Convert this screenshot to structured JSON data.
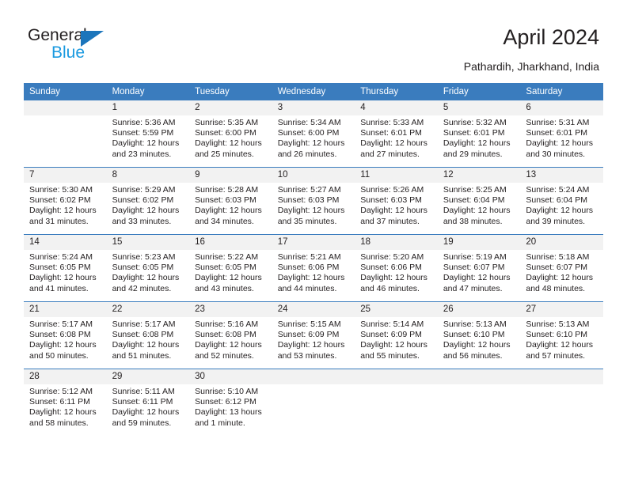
{
  "brand": {
    "name_top": "General",
    "name_bottom": "Blue",
    "accent_color": "#1b75bb",
    "accent_color_light": "#1b9ae0"
  },
  "header": {
    "title": "April 2024",
    "subtitle": "Pathardih, Jharkhand, India"
  },
  "theme": {
    "header_row_bg": "#3a7cbe",
    "daynum_bg": "#f2f2f2",
    "text_color": "#231f20"
  },
  "calendar": {
    "weekday_headers": [
      "Sunday",
      "Monday",
      "Tuesday",
      "Wednesday",
      "Thursday",
      "Friday",
      "Saturday"
    ],
    "weeks": [
      [
        {
          "day": "",
          "sunrise": "",
          "sunset": "",
          "daylight": "",
          "empty": true
        },
        {
          "day": "1",
          "sunrise": "Sunrise: 5:36 AM",
          "sunset": "Sunset: 5:59 PM",
          "daylight": "Daylight: 12 hours and 23 minutes."
        },
        {
          "day": "2",
          "sunrise": "Sunrise: 5:35 AM",
          "sunset": "Sunset: 6:00 PM",
          "daylight": "Daylight: 12 hours and 25 minutes."
        },
        {
          "day": "3",
          "sunrise": "Sunrise: 5:34 AM",
          "sunset": "Sunset: 6:00 PM",
          "daylight": "Daylight: 12 hours and 26 minutes."
        },
        {
          "day": "4",
          "sunrise": "Sunrise: 5:33 AM",
          "sunset": "Sunset: 6:01 PM",
          "daylight": "Daylight: 12 hours and 27 minutes."
        },
        {
          "day": "5",
          "sunrise": "Sunrise: 5:32 AM",
          "sunset": "Sunset: 6:01 PM",
          "daylight": "Daylight: 12 hours and 29 minutes."
        },
        {
          "day": "6",
          "sunrise": "Sunrise: 5:31 AM",
          "sunset": "Sunset: 6:01 PM",
          "daylight": "Daylight: 12 hours and 30 minutes."
        }
      ],
      [
        {
          "day": "7",
          "sunrise": "Sunrise: 5:30 AM",
          "sunset": "Sunset: 6:02 PM",
          "daylight": "Daylight: 12 hours and 31 minutes."
        },
        {
          "day": "8",
          "sunrise": "Sunrise: 5:29 AM",
          "sunset": "Sunset: 6:02 PM",
          "daylight": "Daylight: 12 hours and 33 minutes."
        },
        {
          "day": "9",
          "sunrise": "Sunrise: 5:28 AM",
          "sunset": "Sunset: 6:03 PM",
          "daylight": "Daylight: 12 hours and 34 minutes."
        },
        {
          "day": "10",
          "sunrise": "Sunrise: 5:27 AM",
          "sunset": "Sunset: 6:03 PM",
          "daylight": "Daylight: 12 hours and 35 minutes."
        },
        {
          "day": "11",
          "sunrise": "Sunrise: 5:26 AM",
          "sunset": "Sunset: 6:03 PM",
          "daylight": "Daylight: 12 hours and 37 minutes."
        },
        {
          "day": "12",
          "sunrise": "Sunrise: 5:25 AM",
          "sunset": "Sunset: 6:04 PM",
          "daylight": "Daylight: 12 hours and 38 minutes."
        },
        {
          "day": "13",
          "sunrise": "Sunrise: 5:24 AM",
          "sunset": "Sunset: 6:04 PM",
          "daylight": "Daylight: 12 hours and 39 minutes."
        }
      ],
      [
        {
          "day": "14",
          "sunrise": "Sunrise: 5:24 AM",
          "sunset": "Sunset: 6:05 PM",
          "daylight": "Daylight: 12 hours and 41 minutes."
        },
        {
          "day": "15",
          "sunrise": "Sunrise: 5:23 AM",
          "sunset": "Sunset: 6:05 PM",
          "daylight": "Daylight: 12 hours and 42 minutes."
        },
        {
          "day": "16",
          "sunrise": "Sunrise: 5:22 AM",
          "sunset": "Sunset: 6:05 PM",
          "daylight": "Daylight: 12 hours and 43 minutes."
        },
        {
          "day": "17",
          "sunrise": "Sunrise: 5:21 AM",
          "sunset": "Sunset: 6:06 PM",
          "daylight": "Daylight: 12 hours and 44 minutes."
        },
        {
          "day": "18",
          "sunrise": "Sunrise: 5:20 AM",
          "sunset": "Sunset: 6:06 PM",
          "daylight": "Daylight: 12 hours and 46 minutes."
        },
        {
          "day": "19",
          "sunrise": "Sunrise: 5:19 AM",
          "sunset": "Sunset: 6:07 PM",
          "daylight": "Daylight: 12 hours and 47 minutes."
        },
        {
          "day": "20",
          "sunrise": "Sunrise: 5:18 AM",
          "sunset": "Sunset: 6:07 PM",
          "daylight": "Daylight: 12 hours and 48 minutes."
        }
      ],
      [
        {
          "day": "21",
          "sunrise": "Sunrise: 5:17 AM",
          "sunset": "Sunset: 6:08 PM",
          "daylight": "Daylight: 12 hours and 50 minutes."
        },
        {
          "day": "22",
          "sunrise": "Sunrise: 5:17 AM",
          "sunset": "Sunset: 6:08 PM",
          "daylight": "Daylight: 12 hours and 51 minutes."
        },
        {
          "day": "23",
          "sunrise": "Sunrise: 5:16 AM",
          "sunset": "Sunset: 6:08 PM",
          "daylight": "Daylight: 12 hours and 52 minutes."
        },
        {
          "day": "24",
          "sunrise": "Sunrise: 5:15 AM",
          "sunset": "Sunset: 6:09 PM",
          "daylight": "Daylight: 12 hours and 53 minutes."
        },
        {
          "day": "25",
          "sunrise": "Sunrise: 5:14 AM",
          "sunset": "Sunset: 6:09 PM",
          "daylight": "Daylight: 12 hours and 55 minutes."
        },
        {
          "day": "26",
          "sunrise": "Sunrise: 5:13 AM",
          "sunset": "Sunset: 6:10 PM",
          "daylight": "Daylight: 12 hours and 56 minutes."
        },
        {
          "day": "27",
          "sunrise": "Sunrise: 5:13 AM",
          "sunset": "Sunset: 6:10 PM",
          "daylight": "Daylight: 12 hours and 57 minutes."
        }
      ],
      [
        {
          "day": "28",
          "sunrise": "Sunrise: 5:12 AM",
          "sunset": "Sunset: 6:11 PM",
          "daylight": "Daylight: 12 hours and 58 minutes."
        },
        {
          "day": "29",
          "sunrise": "Sunrise: 5:11 AM",
          "sunset": "Sunset: 6:11 PM",
          "daylight": "Daylight: 12 hours and 59 minutes."
        },
        {
          "day": "30",
          "sunrise": "Sunrise: 5:10 AM",
          "sunset": "Sunset: 6:12 PM",
          "daylight": "Daylight: 13 hours and 1 minute."
        },
        {
          "day": "",
          "sunrise": "",
          "sunset": "",
          "daylight": "",
          "empty": true
        },
        {
          "day": "",
          "sunrise": "",
          "sunset": "",
          "daylight": "",
          "empty": true
        },
        {
          "day": "",
          "sunrise": "",
          "sunset": "",
          "daylight": "",
          "empty": true
        },
        {
          "day": "",
          "sunrise": "",
          "sunset": "",
          "daylight": "",
          "empty": true
        }
      ]
    ]
  }
}
